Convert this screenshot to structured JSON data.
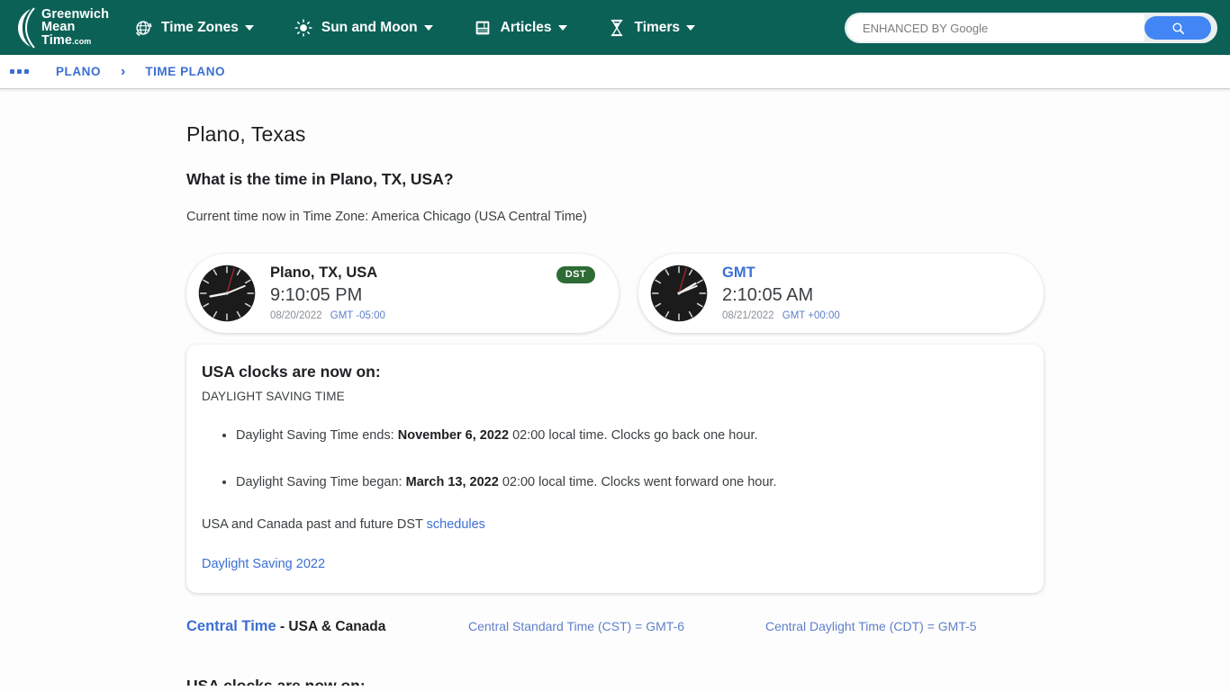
{
  "header": {
    "logo": {
      "line1": "Greenwich",
      "line2": "Mean",
      "line3": "Time",
      "suffix": ".com"
    },
    "nav": [
      {
        "label": "Time Zones",
        "icon": "globe-icon"
      },
      {
        "label": "Sun and Moon",
        "icon": "sun-icon"
      },
      {
        "label": "Articles",
        "icon": "book-icon"
      },
      {
        "label": "Timers",
        "icon": "hourglass-icon"
      }
    ],
    "search": {
      "placeholder": "ENHANCED BY Google",
      "value": "",
      "button_icon": "search-icon"
    },
    "colors": {
      "nav_background": "#0c6157",
      "search_button": "#4285f4"
    }
  },
  "breadcrumb": {
    "menu_icon": "more-dots-icon",
    "items": [
      "PLANO",
      "TIME PLANO"
    ],
    "separator": "›"
  },
  "main": {
    "city_title": "Plano, Texas",
    "question": "What is the time in Plano, TX, USA?",
    "subline": "Current time now in Time Zone: America Chicago (USA Central Time)",
    "clocks": [
      {
        "title": "Plano, TX, USA",
        "title_is_link": false,
        "time": "9:10:05 PM",
        "date": "08/20/2022",
        "gmt_offset": "GMT -05:00",
        "badge": "DST",
        "clock_hours": 9,
        "clock_minutes": 10,
        "clock_seconds": 5
      },
      {
        "title": "GMT",
        "title_is_link": true,
        "time": "2:10:05 AM",
        "date": "08/21/2022",
        "gmt_offset": "GMT +00:00",
        "badge": "",
        "clock_hours": 2,
        "clock_minutes": 10,
        "clock_seconds": 5
      }
    ],
    "dst_card": {
      "heading": "USA clocks are now on:",
      "subheading": "DAYLIGHT SAVING TIME",
      "bullets": [
        {
          "prefix": "Daylight Saving Time ends: ",
          "date": "November 6, 2022",
          "suffix": " 02:00 local time. Clocks go back one hour."
        },
        {
          "prefix": "Daylight Saving Time began: ",
          "date": "March 13, 2022",
          "suffix": " 02:00 local time. Clocks went forward one hour."
        }
      ],
      "footer_text": "USA and Canada past and future DST ",
      "footer_link": "schedules",
      "bottom_link": "Daylight Saving 2022"
    },
    "central_row": {
      "zone_link": "Central Time",
      "zone_rest": " - USA & Canada",
      "standard": "Central Standard Time (CST) = GMT-6",
      "daylight": "Central Daylight Time (CDT) = GMT-5"
    },
    "cutoff_heading": "USA clocks are now on:"
  }
}
